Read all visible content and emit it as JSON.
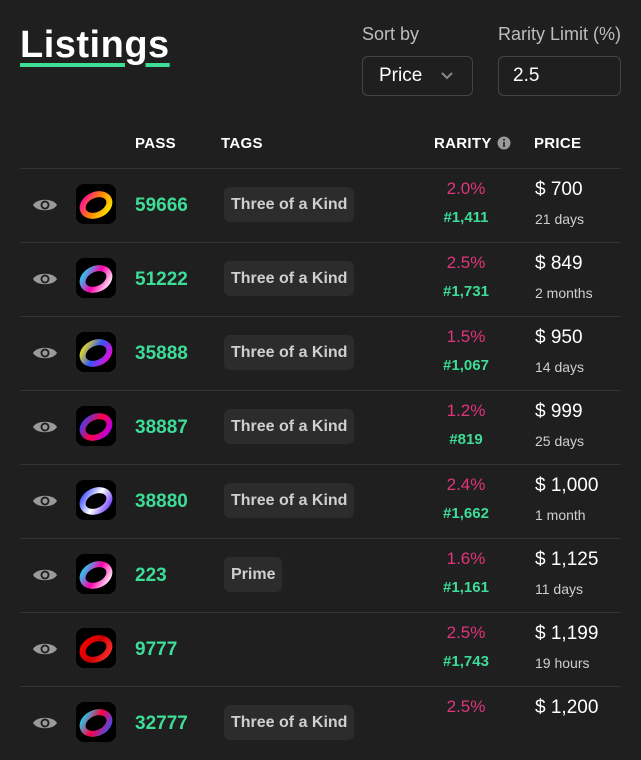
{
  "page": {
    "title": "Listings"
  },
  "controls": {
    "sort_label": "Sort by",
    "sort_value": "Price",
    "limit_label": "Rarity Limit (%)",
    "limit_value": "2.5"
  },
  "columns": {
    "pass": "PASS",
    "tags": "TAGS",
    "rarity": "RARITY",
    "price": "PRICE"
  },
  "colors": {
    "accent": "#3ddc97",
    "rarity_pct": "#e0357a"
  },
  "rows": [
    {
      "pass": "59666",
      "tag": "Three of a Kind",
      "rarity": "2.0%",
      "rank": "#1,411",
      "price": "$ 700",
      "age": "21 days",
      "ring": [
        "#ff00aa",
        "#ff8800",
        "#ffee00"
      ]
    },
    {
      "pass": "51222",
      "tag": "Three of a Kind",
      "rarity": "2.5%",
      "rank": "#1,731",
      "price": "$ 849",
      "age": "2 months",
      "ring": [
        "#00eaff",
        "#ff00aa",
        "#ffffff"
      ]
    },
    {
      "pass": "35888",
      "tag": "Three of a Kind",
      "rarity": "1.5%",
      "rank": "#1,067",
      "price": "$ 950",
      "age": "14 days",
      "ring": [
        "#ffee00",
        "#3355ff",
        "#ff00cc"
      ]
    },
    {
      "pass": "38887",
      "tag": "Three of a Kind",
      "rarity": "1.2%",
      "rank": "#819",
      "price": "$ 999",
      "age": "25 days",
      "ring": [
        "#3344ff",
        "#ff0044",
        "#aa00ff"
      ]
    },
    {
      "pass": "38880",
      "tag": "Three of a Kind",
      "rarity": "2.4%",
      "rank": "#1,662",
      "price": "$ 1,000",
      "age": "1 month",
      "ring": [
        "#3344ff",
        "#ffffff",
        "#6633ff"
      ]
    },
    {
      "pass": "223",
      "tag": "Prime",
      "rarity": "1.6%",
      "rank": "#1,161",
      "price": "$ 1,125",
      "age": "11 days",
      "ring": [
        "#00eaff",
        "#ff00aa",
        "#ffffff"
      ]
    },
    {
      "pass": "9777",
      "tag": "",
      "rarity": "2.5%",
      "rank": "#1,743",
      "price": "$ 1,199",
      "age": "19 hours",
      "ring": [
        "#ff0000",
        "#cc0000",
        "#ff3333"
      ]
    },
    {
      "pass": "32777",
      "tag": "Three of a Kind",
      "rarity": "2.5%",
      "rank": "",
      "price": "$ 1,200",
      "age": "",
      "ring": [
        "#00eaff",
        "#ff0044",
        "#3355ff"
      ]
    }
  ]
}
